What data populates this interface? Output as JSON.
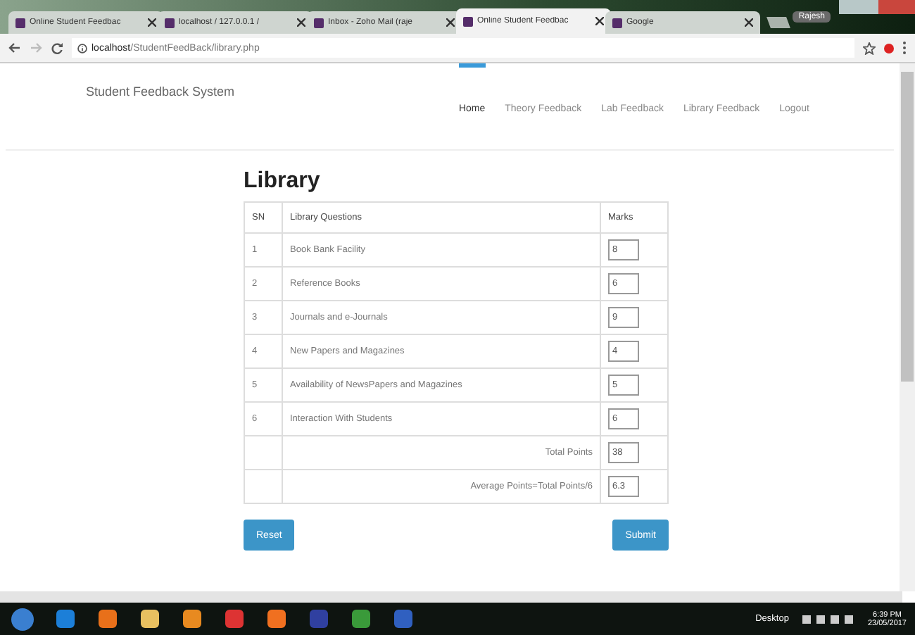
{
  "browser": {
    "tabs": [
      {
        "title": "Online Student Feedbac",
        "selected": false
      },
      {
        "title": "localhost / 127.0.0.1 /",
        "selected": false
      },
      {
        "title": "Inbox - Zoho Mail (raje",
        "selected": false
      },
      {
        "title": "Online Student Feedbac",
        "selected": true
      },
      {
        "title": "Google",
        "selected": false
      }
    ],
    "user": "Rajesh",
    "address": {
      "host": "localhost",
      "path": "/StudentFeedBack/library.php"
    }
  },
  "page": {
    "brand": "Student Feedback System",
    "nav": [
      {
        "label": "Home",
        "selected": true
      },
      {
        "label": "Theory Feedback",
        "selected": false
      },
      {
        "label": "Lab Feedback",
        "selected": false
      },
      {
        "label": "Library Feedback",
        "selected": false
      },
      {
        "label": "Logout",
        "selected": false
      }
    ],
    "heading": "Library",
    "table": {
      "columns": [
        "SN",
        "Library Questions",
        "Marks"
      ],
      "rows": [
        {
          "sn": "1",
          "question": "Book Bank Facility",
          "mark": "8"
        },
        {
          "sn": "2",
          "question": "Reference Books",
          "mark": "6"
        },
        {
          "sn": "3",
          "question": "Journals and e-Journals",
          "mark": "9"
        },
        {
          "sn": "4",
          "question": "New Papers and Magazines",
          "mark": "4"
        },
        {
          "sn": "5",
          "question": "Availability of NewsPapers and Magazines",
          "mark": "5"
        },
        {
          "sn": "6",
          "question": "Interaction With Students",
          "mark": "6"
        }
      ],
      "totals": [
        {
          "label": "Total Points",
          "value": "38"
        },
        {
          "label": "Average Points=Total Points/6",
          "value": "6.3"
        }
      ]
    },
    "buttons": [
      "Reset",
      "Submit"
    ]
  },
  "taskbar": {
    "desktop": "Desktop",
    "time": "6:39 PM",
    "date": "23/05/2017"
  }
}
